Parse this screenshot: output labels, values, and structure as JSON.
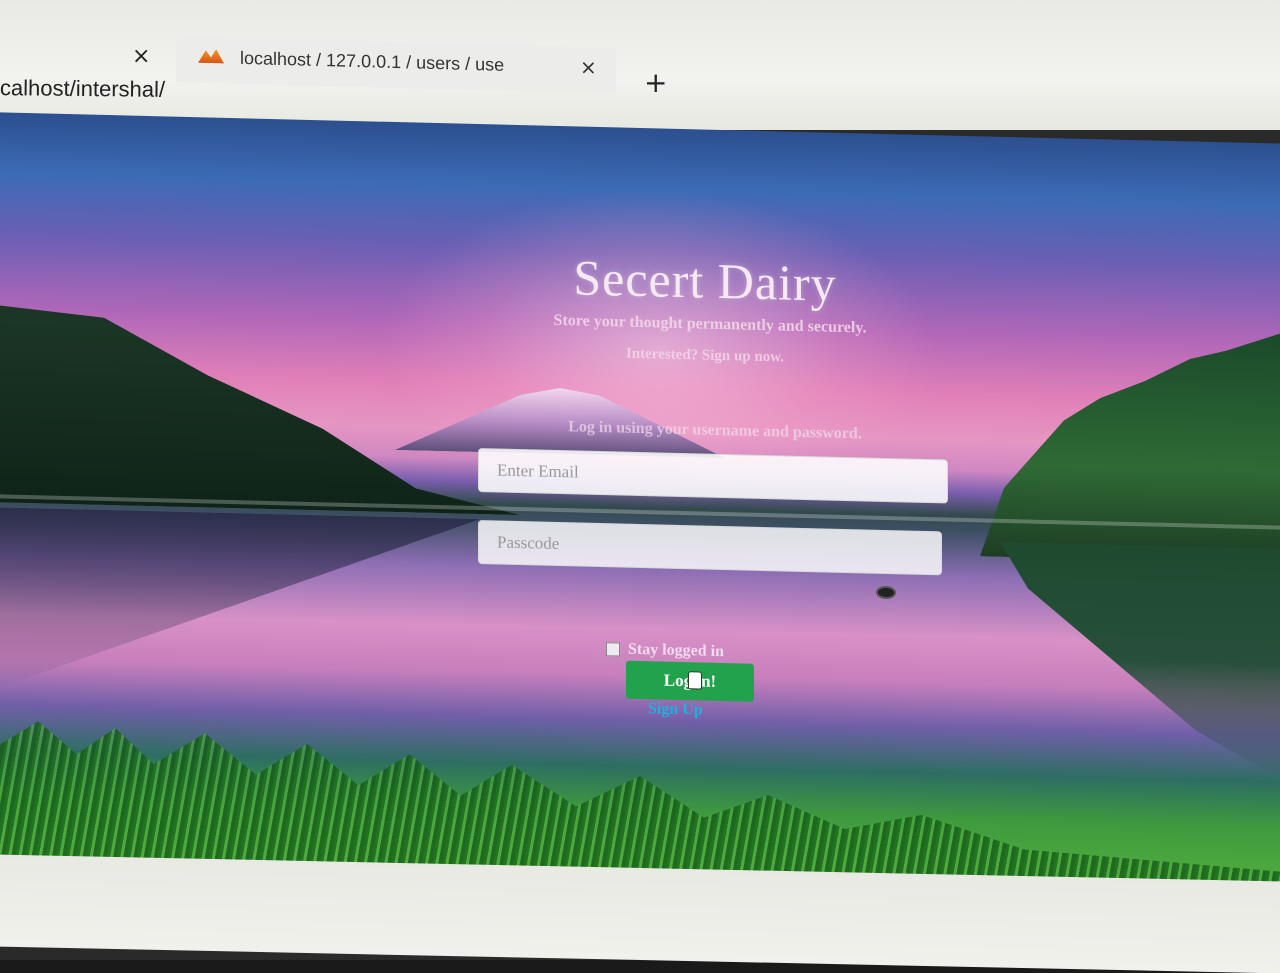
{
  "browser": {
    "prev_tab_close": "×",
    "tab": {
      "title": "localhost / 127.0.0.1 / users / use",
      "close": "×",
      "favicon": "phpmyadmin-icon"
    },
    "new_tab": "+",
    "url": "calhost/intershal/"
  },
  "page": {
    "title": "Secert Dairy",
    "tagline": "Store your thought permanently and securely.",
    "interested": "Interested? Sign up now.",
    "instruction": "Log in using your username and password.",
    "email_placeholder": "Enter Email",
    "password_placeholder": "Passcode",
    "stay_logged_in": "Stay logged in",
    "login_button": "Log in!",
    "signup_link": "Sign Up"
  },
  "colors": {
    "login_button": "#23a24d",
    "signup_link": "#1fb0e0"
  }
}
